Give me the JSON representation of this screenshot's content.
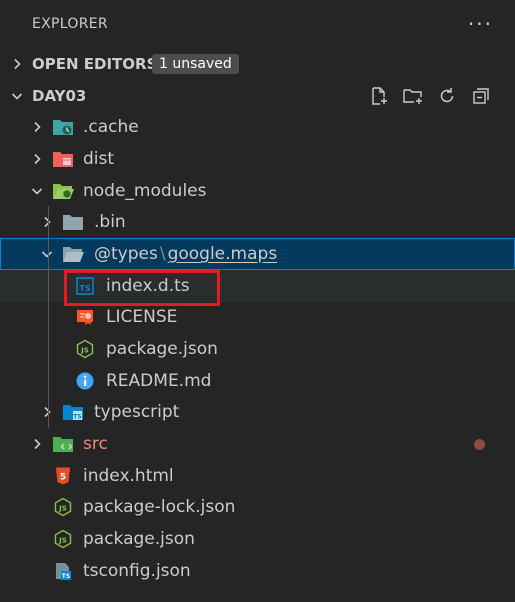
{
  "header": {
    "title": "EXPLORER",
    "more": "···"
  },
  "open_editors": {
    "label": "OPEN EDITORS",
    "badge": "1 unsaved"
  },
  "workspace": {
    "label": "DAY03"
  },
  "tree": {
    "cache": ".cache",
    "dist": "dist",
    "node_modules": "node_modules",
    "bin": ".bin",
    "types": "@types",
    "types_sep": "\\",
    "google_maps": "google.maps",
    "index_d_ts": "index.d.ts",
    "license": "LICENSE",
    "package_json_inner": "package.json",
    "readme": "README.md",
    "typescript": "typescript",
    "src": "src",
    "index_html": "index.html",
    "package_lock": "package-lock.json",
    "package_json": "package.json",
    "tsconfig": "tsconfig.json"
  },
  "colors": {
    "background": "#252526",
    "selection": "#04395e",
    "selection_border": "#007fd4",
    "highlight_box": "#e51b23",
    "modified_src": "#f48771",
    "modified_dot": "#8c4b44",
    "folder_cache": "#40a6a0",
    "folder_dist": "#f25d5d",
    "folder_node_modules": "#8bc34a",
    "folder_generic": "#90a4ae",
    "folder_typescript": "#0288d1",
    "folder_src": "#4caf50"
  },
  "icons": {
    "chevron": "chevron-icon",
    "new_file": "new-file-icon",
    "new_folder": "new-folder-icon",
    "refresh": "refresh-icon",
    "collapse": "collapse-all-icon",
    "ts": "typescript-file-icon",
    "license": "license-icon",
    "json": "nodejs-json-icon",
    "info": "info-icon",
    "html": "html5-icon"
  }
}
